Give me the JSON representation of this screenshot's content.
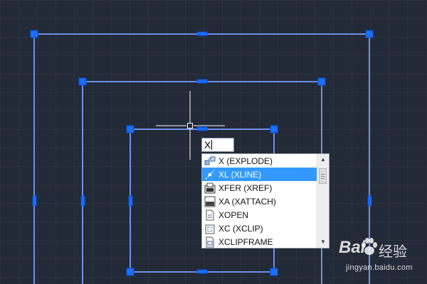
{
  "canvas": {
    "background": "#232a37",
    "line_color": "#6f8fe8",
    "grip_color": "#1a6fff"
  },
  "command_input": {
    "value": "X"
  },
  "autocomplete": {
    "selected_index": 1,
    "items": [
      {
        "label": "X (EXPLODE)",
        "icon": "explode-icon"
      },
      {
        "label": "XL (XLINE)",
        "icon": "xline-icon"
      },
      {
        "label": "XFER (XREF)",
        "icon": "xref-icon"
      },
      {
        "label": "XA (XATTACH)",
        "icon": "xattach-icon"
      },
      {
        "label": "XOPEN",
        "icon": "xopen-icon"
      },
      {
        "label": "XC (XCLIP)",
        "icon": "xclip-icon"
      },
      {
        "label": "XCLIPFRAME",
        "icon": "xclipframe-icon"
      }
    ],
    "scroll_up": "▲",
    "scroll_down": "▼"
  },
  "watermark": {
    "brand": "Bai",
    "brand_suffix": "经验",
    "url": "jingyan.baidu.com"
  }
}
